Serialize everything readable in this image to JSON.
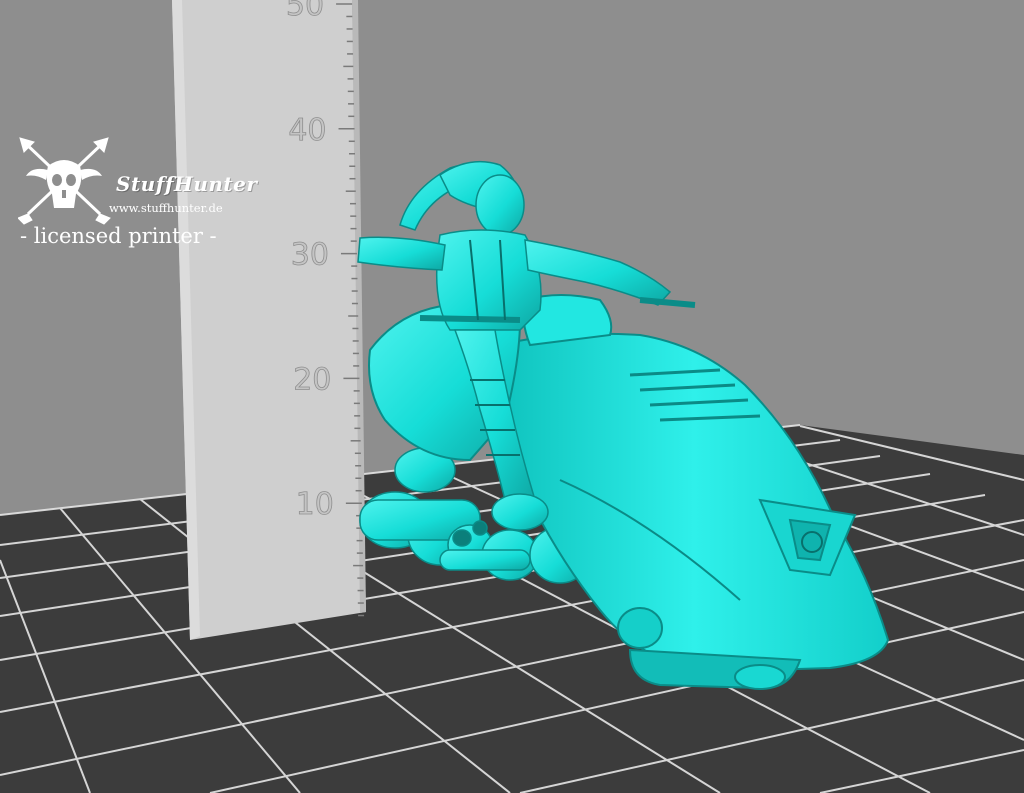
{
  "watermark": {
    "brand": "StuffHunter",
    "url": "www.stuffhunter.de",
    "license_text": "- licensed printer -"
  },
  "ruler": {
    "unit_labels": [
      "10",
      "20",
      "30",
      "40",
      "50"
    ]
  },
  "scene": {
    "subject": "cyberpunk rider on hover bike miniature",
    "model_color": "#1ee6e0",
    "background_color": "#8e8e8e",
    "floor_color": "#3c3c3c",
    "grid_line_color": "#e6e6e6",
    "ruler_color": "#cfcfcf"
  }
}
